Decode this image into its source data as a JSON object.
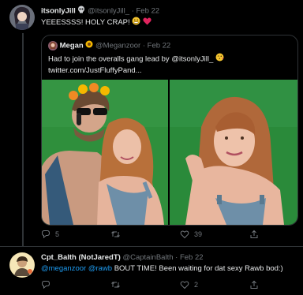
{
  "tweet1": {
    "name": "itsonlyJill",
    "name_emoji": "skull",
    "handle": "@itsonlyJill_",
    "dot": "·",
    "date": "Feb 22",
    "text": "YEEESSSS! HOLY CRAP!"
  },
  "quote": {
    "name": "Megan",
    "handle": "@Meganzoor",
    "dot": "·",
    "date": "Feb 22",
    "text_prefix": "Had to join the overalls gang lead by ",
    "mention": "@itsonlyJill_",
    "link": "twitter.com/JustFluffyPand..."
  },
  "actions1": {
    "replies": "5",
    "retweets": "",
    "likes": "39"
  },
  "tweet2": {
    "name": "Cpt_Balth (NotJaredT)",
    "handle": "@CaptainBalth",
    "dot": "·",
    "date": "Feb 22",
    "mention1": "@meganzoor",
    "mention2": "@rawb",
    "text_rest": " BOUT TIME! Been waiting for dat sexy Rawb bod:)"
  },
  "actions2": {
    "replies": "",
    "retweets": "",
    "likes": "2"
  },
  "colors": {
    "background": "#000000",
    "text": "#e7e9ea",
    "muted": "#71767b",
    "link": "#1d9bf0",
    "border": "#2f3336",
    "green_screen": "#2a8a3a"
  },
  "icons": [
    "reply-icon",
    "retweet-icon",
    "like-icon",
    "share-icon"
  ]
}
